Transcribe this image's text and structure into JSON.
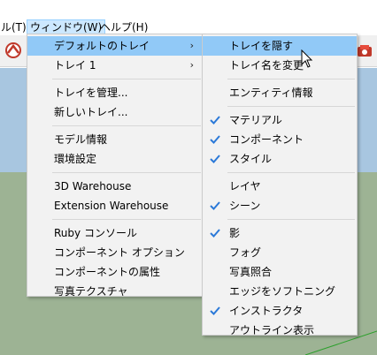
{
  "menubar": {
    "items": [
      {
        "label": "ル(T)"
      },
      {
        "label": "ウィンドウ(W)"
      },
      {
        "label": "ヘルプ(H)"
      }
    ]
  },
  "window_menu": {
    "items": [
      {
        "label": "デフォルトのトレイ",
        "submenu": true
      },
      {
        "label": "トレイ 1",
        "submenu": true
      },
      {
        "label": "トレイを管理..."
      },
      {
        "label": "新しいトレイ..."
      },
      {
        "label": "モデル情報"
      },
      {
        "label": "環境設定"
      },
      {
        "label": "3D Warehouse"
      },
      {
        "label": "Extension Warehouse"
      },
      {
        "label": "Ruby コンソール"
      },
      {
        "label": "コンポーネント オプション"
      },
      {
        "label": "コンポーネントの属性"
      },
      {
        "label": "写真テクスチャ"
      }
    ]
  },
  "tray_submenu": {
    "items": [
      {
        "label": "トレイを隠す",
        "checked": false
      },
      {
        "label": "トレイ名を変更",
        "checked": false
      },
      {
        "label": "エンティティ情報",
        "checked": false
      },
      {
        "label": "マテリアル",
        "checked": true
      },
      {
        "label": "コンポーネント",
        "checked": true
      },
      {
        "label": "スタイル",
        "checked": true
      },
      {
        "label": "レイヤ",
        "checked": false
      },
      {
        "label": "シーン",
        "checked": true
      },
      {
        "label": "影",
        "checked": true
      },
      {
        "label": "フォグ",
        "checked": false
      },
      {
        "label": "写真照合",
        "checked": false
      },
      {
        "label": "エッジをソフトニング",
        "checked": false
      },
      {
        "label": "インストラクタ",
        "checked": true
      },
      {
        "label": "アウトライン表示",
        "checked": false
      }
    ]
  },
  "colors": {
    "highlight": "#91c9f7",
    "checkmark": "#2b79d8",
    "menu_bg": "#f2f2f2",
    "sky": "#a8c6e0",
    "ground": "#9db394"
  }
}
